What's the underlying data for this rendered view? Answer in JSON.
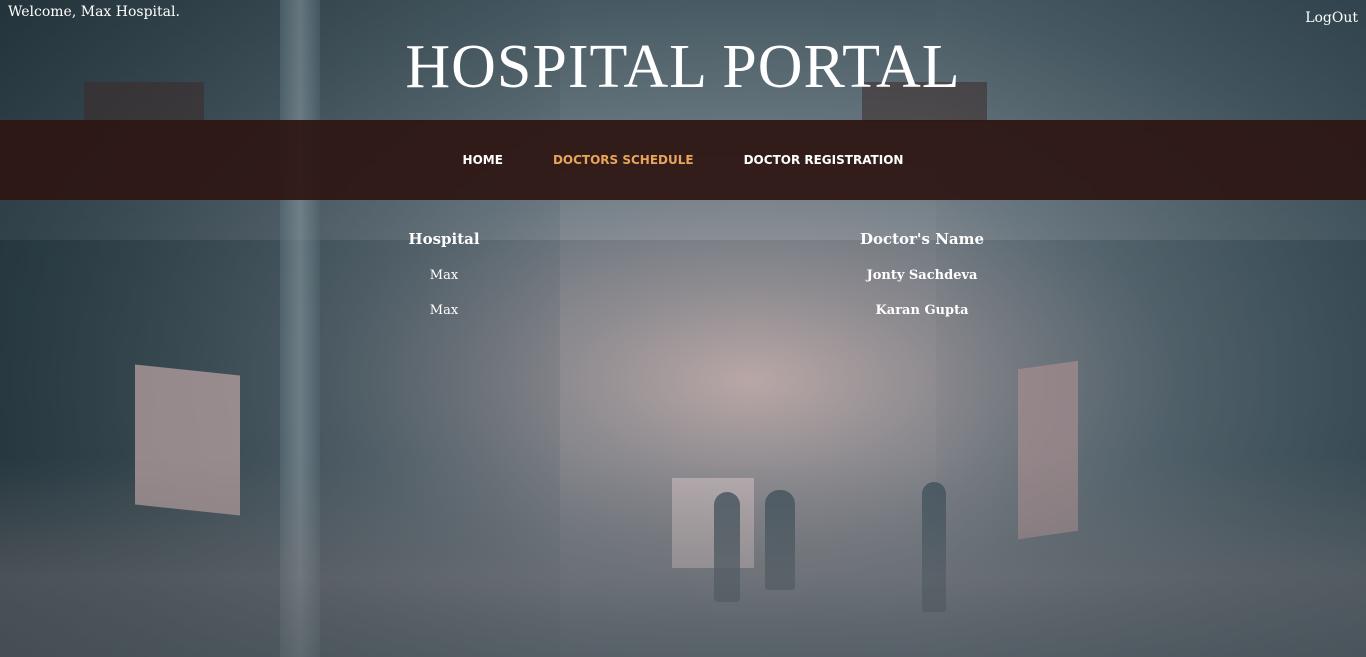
{
  "header": {
    "welcome_text": "Welcome, Max Hospital.",
    "logout_label": "LogOut",
    "title": "HOSPITAL PORTAL"
  },
  "nav": {
    "items": [
      {
        "label": "HOME",
        "active": false
      },
      {
        "label": "DOCTORS SCHEDULE",
        "active": true
      },
      {
        "label": "DOCTOR REGISTRATION",
        "active": false
      }
    ]
  },
  "schedule_table": {
    "columns": [
      "Hospital",
      "Doctor's Name"
    ],
    "rows": [
      {
        "hospital": "Max",
        "doctor": "Jonty Sachdeva"
      },
      {
        "hospital": "Max",
        "doctor": "Karan Gupta"
      }
    ]
  },
  "colors": {
    "navbar_bg": "#2d1612",
    "active_nav": "#e8a45a",
    "text": "#ffffff"
  }
}
